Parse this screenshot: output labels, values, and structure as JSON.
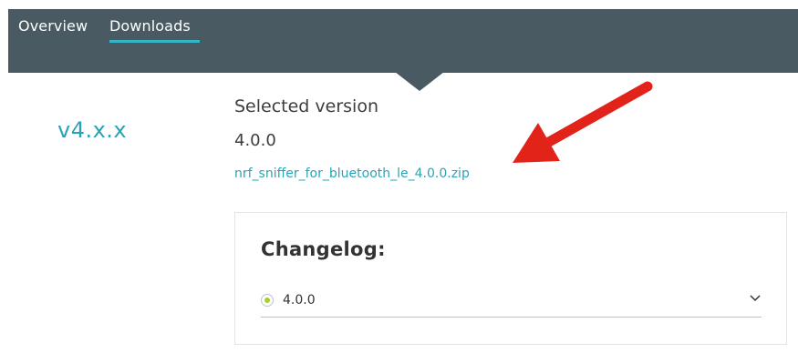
{
  "nav": {
    "tabs": [
      {
        "label": "Overview"
      },
      {
        "label": "Downloads"
      }
    ],
    "active_tab": "Downloads"
  },
  "sidebar": {
    "version_label": "v4.x.x"
  },
  "selected": {
    "title": "Selected version",
    "version": "4.0.0",
    "file_link": "nrf_sniffer_for_bluetooth_le_4.0.0.zip"
  },
  "annotation": {
    "arrow_color": "#e2231a",
    "icon": "red-arrow-icon"
  },
  "changelog": {
    "title": "Changelog:",
    "selected_version": "4.0.0",
    "icon": "chevron-down-icon"
  },
  "colors": {
    "topbar": "#4a5a63",
    "accent": "#2aa3b6",
    "radio": "#a6cf2a"
  }
}
